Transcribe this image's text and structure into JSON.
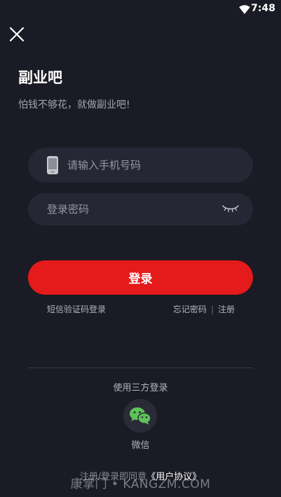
{
  "status_bar": {
    "time": "7:48",
    "wifi_icon": "wifi-icon"
  },
  "header": {
    "close_icon": "close-icon",
    "title": "副业吧",
    "subtitle": "怕钱不够花，就做副业吧!"
  },
  "form": {
    "phone_placeholder": "请输入手机号码",
    "phone_icon": "phone-icon",
    "password_placeholder": "登录密码",
    "eye_icon": "eye-closed-icon",
    "login_label": "登录"
  },
  "links": {
    "sms_login": "短信验证码登录",
    "forgot_password": "忘记密码",
    "separator": "|",
    "register": "注册"
  },
  "third_party": {
    "title": "使用三方登录",
    "wechat_label": "微信",
    "wechat_icon": "wechat-icon"
  },
  "agreement": {
    "prefix": "注册/登录即同意",
    "link": "《用户协议》"
  },
  "watermark": {
    "text": "康掌门 • KANGZM.COM"
  },
  "colors": {
    "background": "#1a1b24",
    "input_background": "#262734",
    "accent": "#e51a1a",
    "wechat_green": "#5ec25a"
  }
}
